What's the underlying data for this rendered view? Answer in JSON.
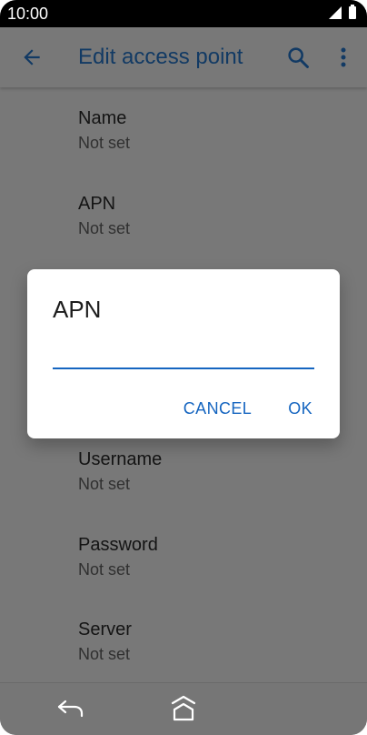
{
  "status_bar": {
    "time": "10:00",
    "icons": [
      "signal-icon",
      "battery-icon"
    ]
  },
  "app_bar": {
    "title": "Edit access point",
    "icons": [
      "back-arrow-icon",
      "search-icon",
      "more-vert-icon"
    ],
    "title_color": "#123a64"
  },
  "preferences": [
    {
      "title": "Name",
      "summary": "Not set"
    },
    {
      "title": "APN",
      "summary": "Not set"
    },
    {
      "title": "Username",
      "summary": "Not set"
    },
    {
      "title": "Password",
      "summary": "Not set"
    },
    {
      "title": "Server",
      "summary": "Not set"
    }
  ],
  "dialog": {
    "title": "APN",
    "input_value": "",
    "cancel_label": "CANCEL",
    "ok_label": "OK",
    "accent_color": "#1565c0"
  },
  "nav_bar": {
    "icons": [
      "nav-back-icon",
      "home-icon"
    ]
  }
}
